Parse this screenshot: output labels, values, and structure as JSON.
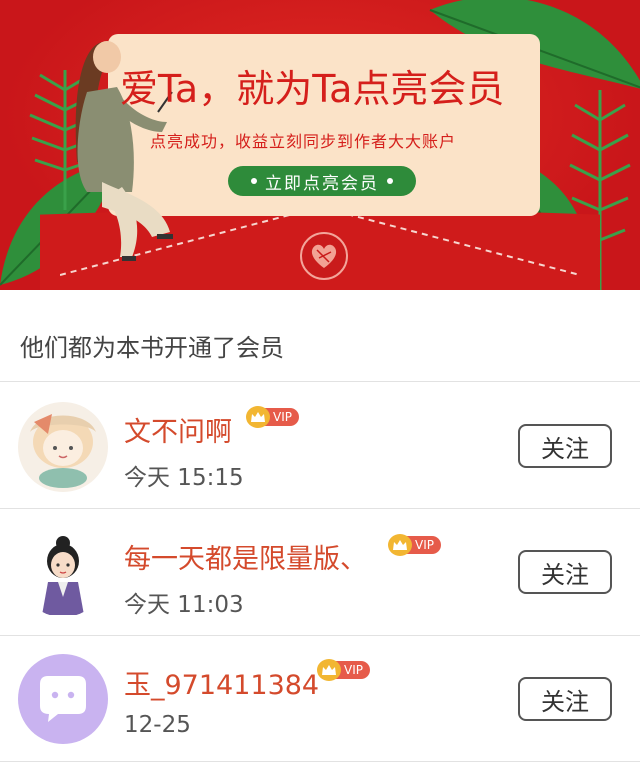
{
  "banner": {
    "headline": "爱Ta，就为Ta点亮会员",
    "subline": "点亮成功，收益立刻同步到作者大大账户",
    "cta_label": "立即点亮会员"
  },
  "section": {
    "title": "他们都为本书开通了会员"
  },
  "members": [
    {
      "name": "文不问啊",
      "vip_label": "VIP",
      "time": "今天 15:15",
      "follow_label": "关注"
    },
    {
      "name": "每一天都是限量版、",
      "vip_label": "VIP",
      "time": "今天 11:03",
      "follow_label": "关注"
    },
    {
      "name": "玉_971411384",
      "vip_label": "VIP",
      "time": "12-25",
      "follow_label": "关注"
    }
  ],
  "colors": {
    "banner_red": "#d51f1b",
    "card_cream": "#fbe3c8",
    "cta_green": "#2e8b3a",
    "name_red": "#d44a2c",
    "vip_gold": "#f2b632",
    "vip_tag": "#e65b4a"
  },
  "icons": [
    "heart-seal-icon",
    "crown-icon",
    "chat-bubble-icon",
    "leaf-icon"
  ]
}
